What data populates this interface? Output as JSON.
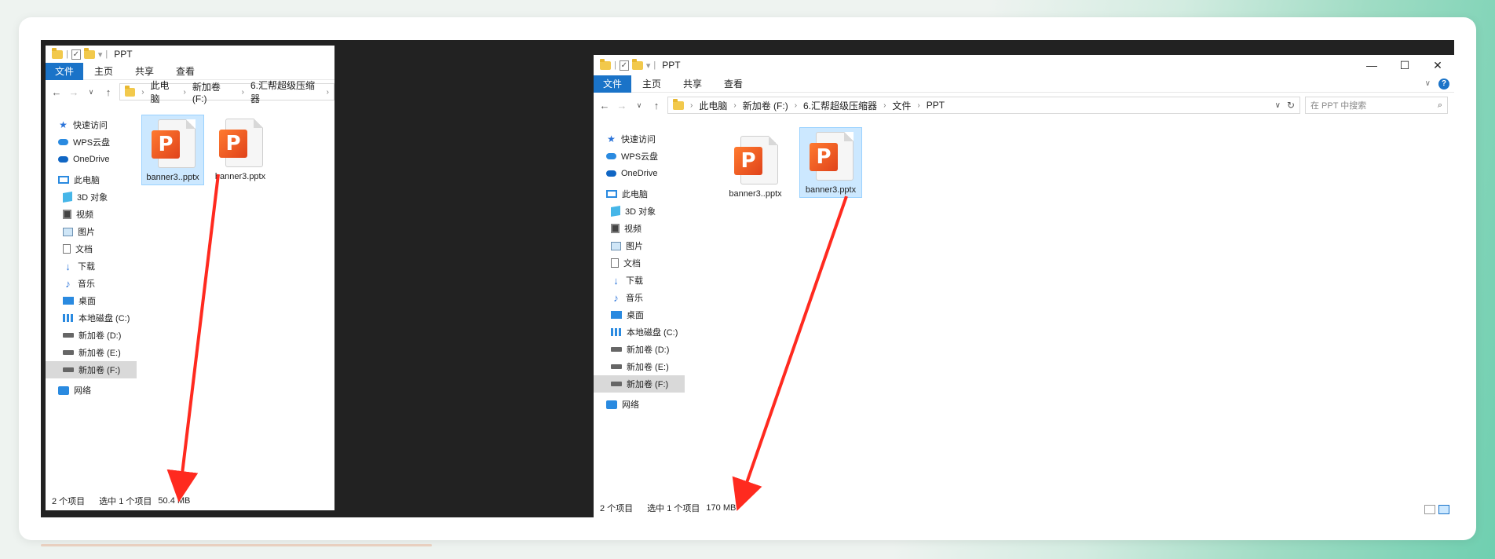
{
  "window_left": {
    "title": "PPT",
    "ribbon": [
      "文件",
      "主页",
      "共享",
      "查看"
    ],
    "breadcrumbs": [
      "此电脑",
      "新加卷 (F:)",
      "6.汇帮超级压缩器"
    ],
    "sidebar": [
      {
        "label": "快速访问",
        "icon": "star-icon",
        "indent": 0
      },
      {
        "label": "WPS云盘",
        "icon": "cloud-icon",
        "indent": 0
      },
      {
        "label": "OneDrive",
        "icon": "onedrive-icon",
        "indent": 0
      },
      {
        "label": "此电脑",
        "icon": "pc-icon",
        "indent": 0
      },
      {
        "label": "3D 对象",
        "icon": "cube-icon",
        "indent": 1
      },
      {
        "label": "视频",
        "icon": "video-icon",
        "indent": 1
      },
      {
        "label": "图片",
        "icon": "picture-icon",
        "indent": 1
      },
      {
        "label": "文档",
        "icon": "document-icon",
        "indent": 1
      },
      {
        "label": "下载",
        "icon": "download-icon",
        "indent": 1
      },
      {
        "label": "音乐",
        "icon": "music-icon",
        "indent": 1
      },
      {
        "label": "桌面",
        "icon": "desktop-icon",
        "indent": 1
      },
      {
        "label": "本地磁盘 (C:)",
        "icon": "system-drive-icon",
        "indent": 1
      },
      {
        "label": "新加卷 (D:)",
        "icon": "drive-icon",
        "indent": 1
      },
      {
        "label": "新加卷 (E:)",
        "icon": "drive-icon",
        "indent": 1
      },
      {
        "label": "新加卷 (F:)",
        "icon": "drive-icon",
        "indent": 1,
        "selected": true
      },
      {
        "label": "网络",
        "icon": "network-icon",
        "indent": 0
      }
    ],
    "files": [
      {
        "name": "banner3..pptx",
        "selected": true
      },
      {
        "name": "banner3.pptx",
        "selected": false
      }
    ],
    "status": {
      "count": "2 个项目",
      "selected": "选中 1 个项目",
      "size": "50.4 MB"
    }
  },
  "window_right": {
    "title": "PPT",
    "ribbon": [
      "文件",
      "主页",
      "共享",
      "查看"
    ],
    "breadcrumbs": [
      "此电脑",
      "新加卷 (F:)",
      "6.汇帮超级压缩器",
      "文件",
      "PPT"
    ],
    "search_placeholder": "在 PPT 中搜索",
    "sidebar": [
      {
        "label": "快速访问",
        "icon": "star-icon",
        "indent": 0
      },
      {
        "label": "WPS云盘",
        "icon": "cloud-icon",
        "indent": 0
      },
      {
        "label": "OneDrive",
        "icon": "onedrive-icon",
        "indent": 0
      },
      {
        "label": "此电脑",
        "icon": "pc-icon",
        "indent": 0
      },
      {
        "label": "3D 对象",
        "icon": "cube-icon",
        "indent": 1
      },
      {
        "label": "视频",
        "icon": "video-icon",
        "indent": 1
      },
      {
        "label": "图片",
        "icon": "picture-icon",
        "indent": 1
      },
      {
        "label": "文档",
        "icon": "document-icon",
        "indent": 1
      },
      {
        "label": "下载",
        "icon": "download-icon",
        "indent": 1
      },
      {
        "label": "音乐",
        "icon": "music-icon",
        "indent": 1
      },
      {
        "label": "桌面",
        "icon": "desktop-icon",
        "indent": 1
      },
      {
        "label": "本地磁盘 (C:)",
        "icon": "system-drive-icon",
        "indent": 1
      },
      {
        "label": "新加卷 (D:)",
        "icon": "drive-icon",
        "indent": 1
      },
      {
        "label": "新加卷 (E:)",
        "icon": "drive-icon",
        "indent": 1
      },
      {
        "label": "新加卷 (F:)",
        "icon": "drive-icon",
        "indent": 1,
        "selected": true
      },
      {
        "label": "网络",
        "icon": "network-icon",
        "indent": 0
      }
    ],
    "files": [
      {
        "name": "banner3..pptx",
        "selected": false
      },
      {
        "name": "banner3.pptx",
        "selected": true
      }
    ],
    "status": {
      "count": "2 个项目",
      "selected": "选中 1 个项目",
      "size": "170 MB"
    }
  },
  "colors": {
    "accent": "#1a73c8",
    "arrow": "#ff2a1f",
    "selection": "#cce8ff",
    "ppt": "#e0431b"
  }
}
